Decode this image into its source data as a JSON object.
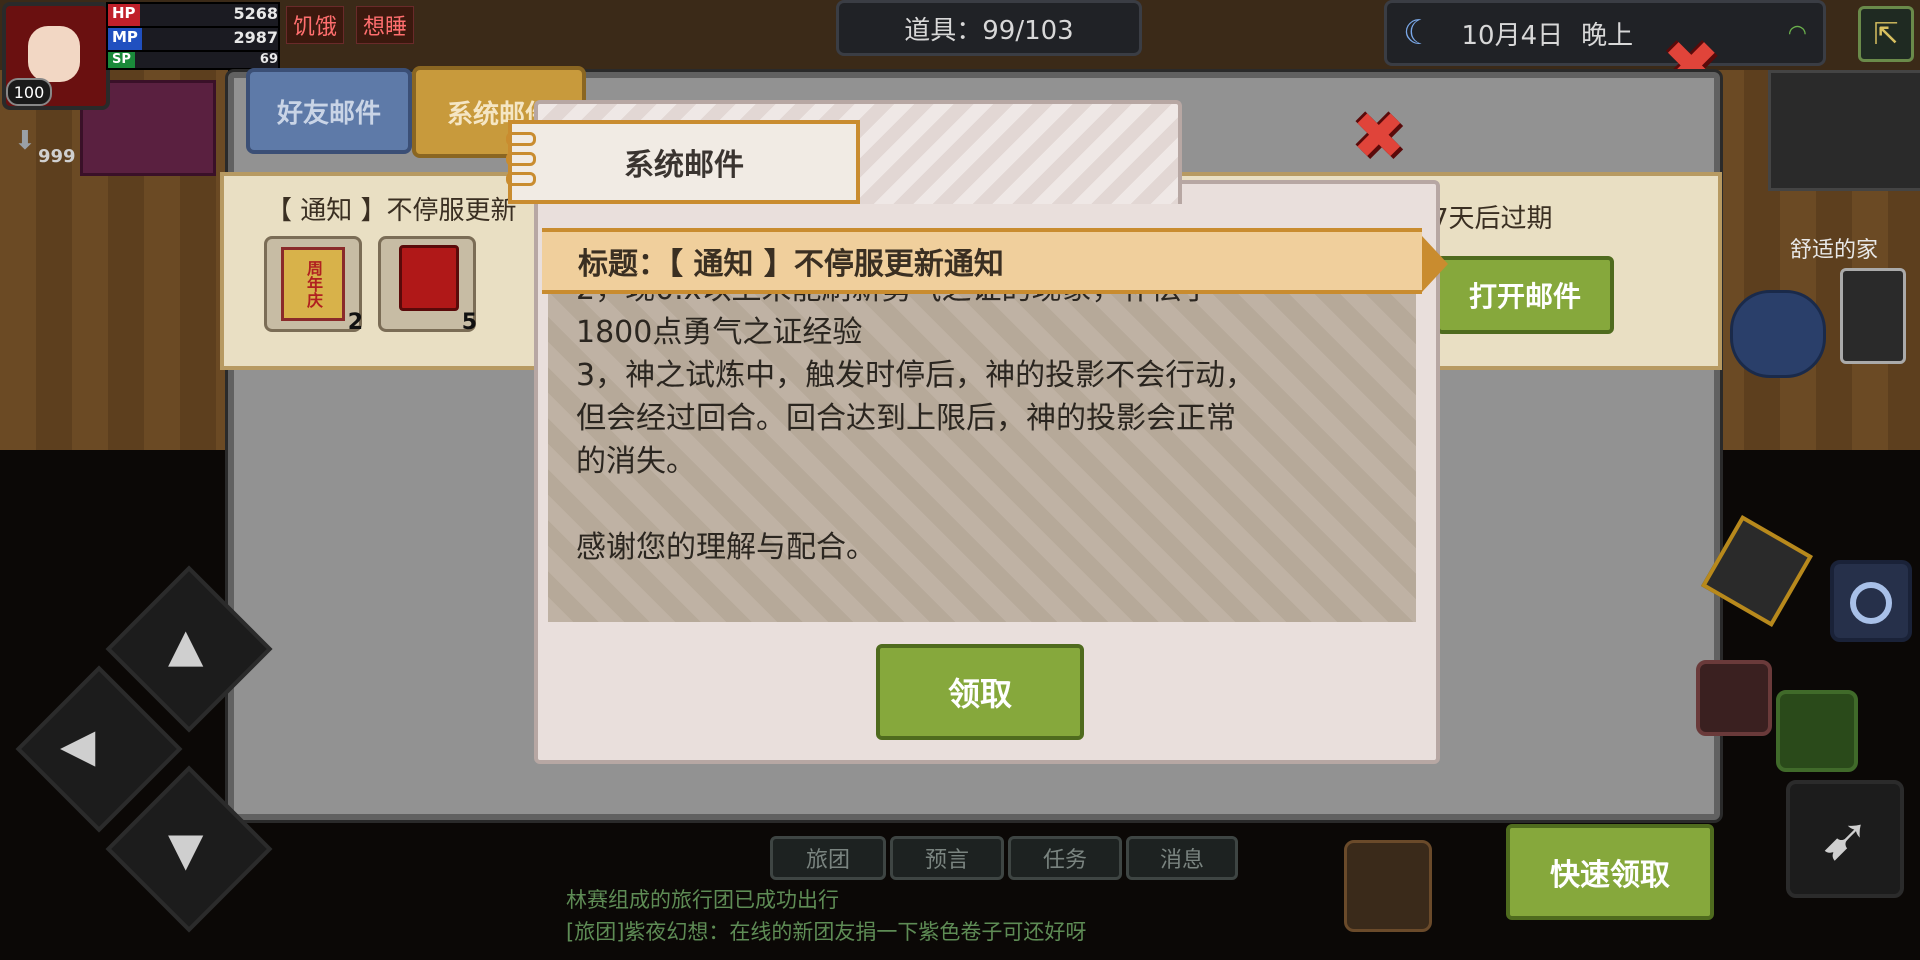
{
  "hud": {
    "hp_label": "HP",
    "hp_value": "5268",
    "mp_label": "MP",
    "mp_value": "2987",
    "sp_label": "SP",
    "sp_value": "69",
    "level": "100",
    "coins": "999",
    "status_hungry": "饥饿",
    "status_sleepy": "想睡",
    "items": "道具：99/103",
    "date": "10月4日",
    "time_of_day": "晚上",
    "location": "舒适的家"
  },
  "mail": {
    "tab_friends": "好友邮件",
    "tab_system": "系统邮件",
    "item_subject": "【 通知 】不停服更新",
    "item_expiry": "7天后过期",
    "reward1_icon": "周年庆",
    "reward1_count": "2",
    "reward2_count": "5",
    "open_button": "打开邮件",
    "quick_claim_button": "快速领取"
  },
  "dialog": {
    "tab_title": "系统邮件",
    "subject": "标题：【 通知 】不停服更新通知",
    "content": "2，现0.x以上未能刷新勇气之证的现象，补偿了\n1800点勇气之证经验\n3，神之试炼中，触发时停后，神的投影不会行动，\n但会经过回合。回合达到上限后，神的投影会正常\n的消失。\n\n感谢您的理解与配合。",
    "claim_button": "领取"
  },
  "chat": {
    "tabs": [
      "旅团",
      "预言",
      "任务",
      "消息"
    ],
    "lines": [
      "林赛组成的旅行团已成功出行",
      "[旅团]紫夜幻想：在线的新团友捐一下紫色卷子可还好呀"
    ]
  },
  "colors": {
    "accent_green": "#86a83c",
    "close_red": "#e0443a",
    "banner_gold": "#f0cf9c"
  }
}
